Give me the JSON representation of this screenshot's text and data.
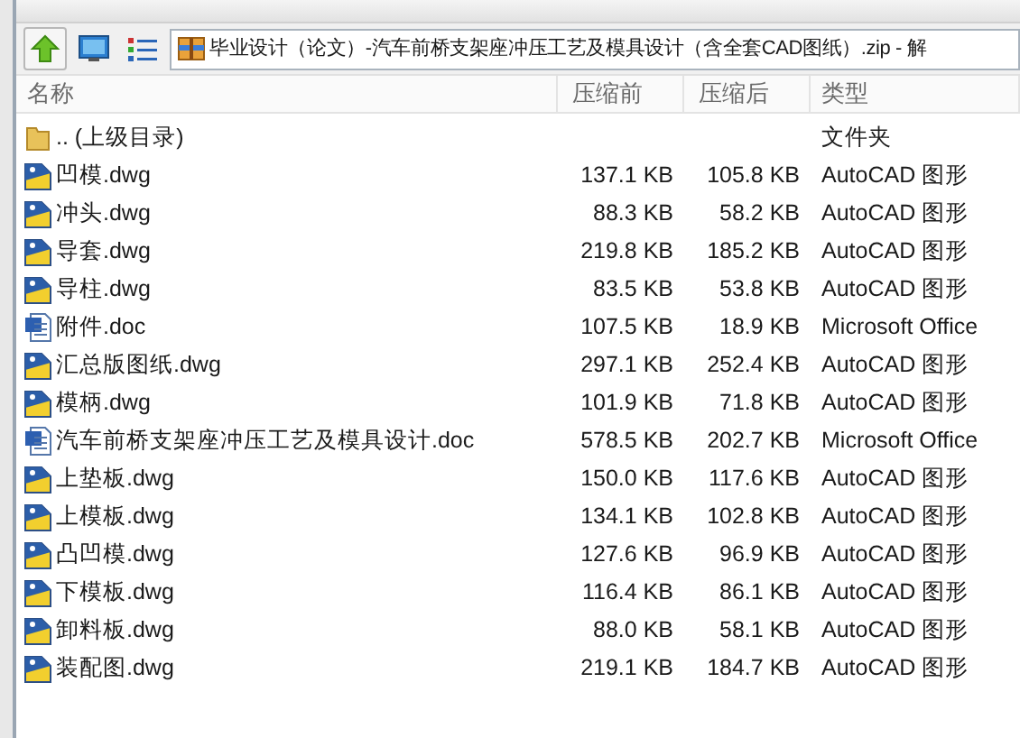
{
  "address": {
    "text": "毕业设计（论文）-汽车前桥支架座冲压工艺及模具设计（含全套CAD图纸）.zip - 解"
  },
  "columns": [
    "名称",
    "压缩前",
    "压缩后",
    "类型"
  ],
  "rows": [
    {
      "kind": "folder",
      "name": ".. (上级目录)",
      "size": "",
      "packed": "",
      "type": "文件夹"
    },
    {
      "kind": "dwg",
      "name": "凹模.dwg",
      "size": "137.1 KB",
      "packed": "105.8 KB",
      "type": "AutoCAD 图形"
    },
    {
      "kind": "dwg",
      "name": "冲头.dwg",
      "size": "88.3 KB",
      "packed": "58.2 KB",
      "type": "AutoCAD 图形"
    },
    {
      "kind": "dwg",
      "name": "导套.dwg",
      "size": "219.8 KB",
      "packed": "185.2 KB",
      "type": "AutoCAD 图形"
    },
    {
      "kind": "dwg",
      "name": "导柱.dwg",
      "size": "83.5 KB",
      "packed": "53.8 KB",
      "type": "AutoCAD 图形"
    },
    {
      "kind": "doc",
      "name": "附件.doc",
      "size": "107.5 KB",
      "packed": "18.9 KB",
      "type": "Microsoft Office"
    },
    {
      "kind": "dwg",
      "name": "汇总版图纸.dwg",
      "size": "297.1 KB",
      "packed": "252.4 KB",
      "type": "AutoCAD 图形"
    },
    {
      "kind": "dwg",
      "name": "模柄.dwg",
      "size": "101.9 KB",
      "packed": "71.8 KB",
      "type": "AutoCAD 图形"
    },
    {
      "kind": "doc",
      "name": "汽车前桥支架座冲压工艺及模具设计.doc",
      "size": "578.5 KB",
      "packed": "202.7 KB",
      "type": "Microsoft Office"
    },
    {
      "kind": "dwg",
      "name": "上垫板.dwg",
      "size": "150.0 KB",
      "packed": "117.6 KB",
      "type": "AutoCAD 图形"
    },
    {
      "kind": "dwg",
      "name": "上模板.dwg",
      "size": "134.1 KB",
      "packed": "102.8 KB",
      "type": "AutoCAD 图形"
    },
    {
      "kind": "dwg",
      "name": "凸凹模.dwg",
      "size": "127.6 KB",
      "packed": "96.9 KB",
      "type": "AutoCAD 图形"
    },
    {
      "kind": "dwg",
      "name": "下模板.dwg",
      "size": "116.4 KB",
      "packed": "86.1 KB",
      "type": "AutoCAD 图形"
    },
    {
      "kind": "dwg",
      "name": "卸料板.dwg",
      "size": "88.0 KB",
      "packed": "58.1 KB",
      "type": "AutoCAD 图形"
    },
    {
      "kind": "dwg",
      "name": "装配图.dwg",
      "size": "219.1 KB",
      "packed": "184.7 KB",
      "type": "AutoCAD 图形"
    }
  ]
}
